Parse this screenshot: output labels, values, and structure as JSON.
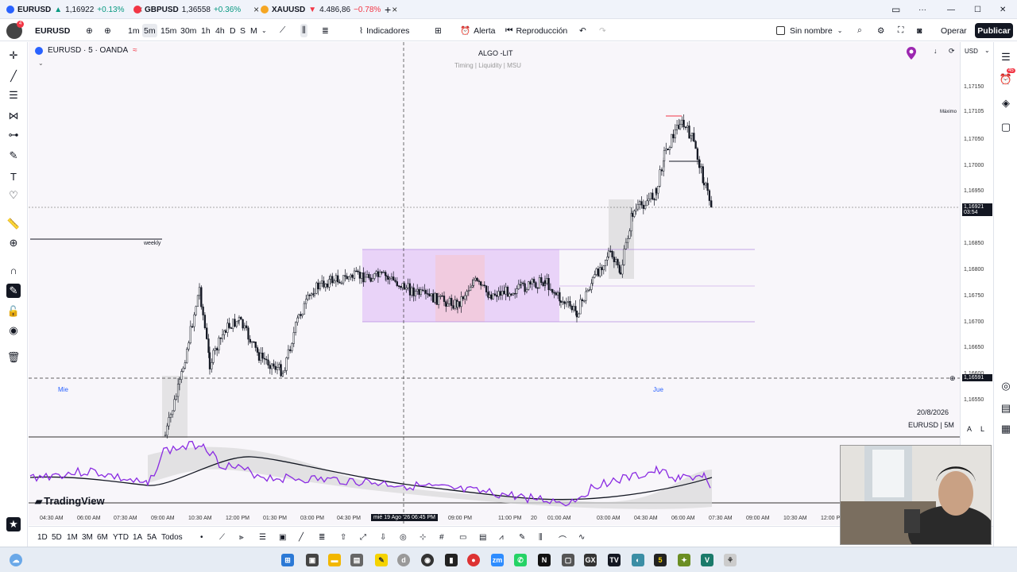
{
  "tabs": [
    {
      "symbol": "EURUSD",
      "price": "1,16922",
      "change": "+0.13%",
      "direction": "up",
      "color": "#2962ff",
      "close": "×"
    },
    {
      "symbol": "GBPUSD",
      "price": "1,36558",
      "change": "+0.36%",
      "direction": "up",
      "color": "#f23645",
      "close": "×"
    },
    {
      "symbol": "XAUUSD",
      "price": "4.486,86",
      "change": "−0.78%",
      "direction": "down",
      "color": "#f5a623",
      "close": "×"
    }
  ],
  "tabbar": {
    "add": "+",
    "minimize": "—",
    "maximize": "☐",
    "close": "✕",
    "more": "···"
  },
  "toolbar": {
    "symbol": "EURUSD",
    "intervals": [
      "1m",
      "5m",
      "15m",
      "30m",
      "1h",
      "4h",
      "D",
      "S",
      "M"
    ],
    "selected_interval": "5m",
    "indicators": "Indicadores",
    "alert": "Alerta",
    "replay": "Reproducción",
    "layout_name": "Sin nombre",
    "trade": "Operar",
    "publish": "Publicar",
    "avatar_badge": "4"
  },
  "chart": {
    "legend": "EURUSD · 5 · OANDA",
    "indicator_title": "ALGO -LIT",
    "indicator_subtitle": "Timing | Liquidity | MSU",
    "weekly_label": "weekly",
    "max_label": "Máximo",
    "day_mie": "Mie",
    "day_jue": "Jue",
    "date_stamp": "20/8/2026",
    "symbol_stamp": "EURUSD | 5M",
    "watermark": "TradingView",
    "currency": "USD",
    "right_badge": "45"
  },
  "price_axis": {
    "labels": [
      "1,17150",
      "1,17105",
      "1,17050",
      "1,17000",
      "1,16950",
      "1,16850",
      "1,16800",
      "1,16750",
      "1,16700",
      "1,16650",
      "1,16600",
      "1,16550"
    ],
    "current_price": "1,16921",
    "countdown": "03:54",
    "crosshair_price": "1,16591",
    "scale_a": "A",
    "scale_l": "L"
  },
  "time_axis": {
    "labels": [
      "04:30 AM",
      "06:00 AM",
      "07:30 AM",
      "09:00 AM",
      "10:30 AM",
      "12:00 PM",
      "01:30 PM",
      "03:00 PM",
      "04:30 PM",
      "09:00 PM",
      "11:00 PM",
      "20",
      "01:00 AM",
      "03:00 AM",
      "04:30 AM",
      "06:00 AM",
      "07:30 AM",
      "09:00 AM",
      "10:30 AM",
      "12:00 PM"
    ],
    "crosshair_time": "mié 19 Ago '26   06:45 PM"
  },
  "ranges": [
    "1D",
    "5D",
    "1M",
    "3M",
    "6M",
    "YTD",
    "1A",
    "5A",
    "Todos"
  ],
  "colors": {
    "up": "#089981",
    "down": "#f23645",
    "accent": "#2962ff",
    "zone": "#e1c8f5",
    "oscillator": "#8a2be2"
  }
}
